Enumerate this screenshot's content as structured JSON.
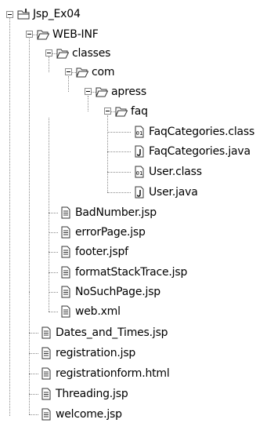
{
  "tree": {
    "root": {
      "label": "Jsp_Ex04",
      "type": "project"
    },
    "nodes": [
      {
        "label": "WEB-INF",
        "type": "folder-open"
      },
      {
        "label": "classes",
        "type": "folder-open"
      },
      {
        "label": "com",
        "type": "folder-open"
      },
      {
        "label": "apress",
        "type": "folder-open"
      },
      {
        "label": "faq",
        "type": "folder-open"
      },
      {
        "label": "FaqCategories.class",
        "type": "class-file"
      },
      {
        "label": "FaqCategories.java",
        "type": "java-file"
      },
      {
        "label": "User.class",
        "type": "class-file"
      },
      {
        "label": "User.java",
        "type": "java-file"
      },
      {
        "label": "BadNumber.jsp",
        "type": "text-file"
      },
      {
        "label": "errorPage.jsp",
        "type": "text-file"
      },
      {
        "label": "footer.jspf",
        "type": "text-file"
      },
      {
        "label": "formatStackTrace.jsp",
        "type": "text-file"
      },
      {
        "label": "NoSuchPage.jsp",
        "type": "text-file"
      },
      {
        "label": "web.xml",
        "type": "text-file"
      },
      {
        "label": "Dates_and_Times.jsp",
        "type": "text-file"
      },
      {
        "label": "registration.jsp",
        "type": "text-file"
      },
      {
        "label": "registrationform.html",
        "type": "text-file"
      },
      {
        "label": "Threading.jsp",
        "type": "text-file"
      },
      {
        "label": "welcome.jsp",
        "type": "text-file"
      }
    ]
  }
}
